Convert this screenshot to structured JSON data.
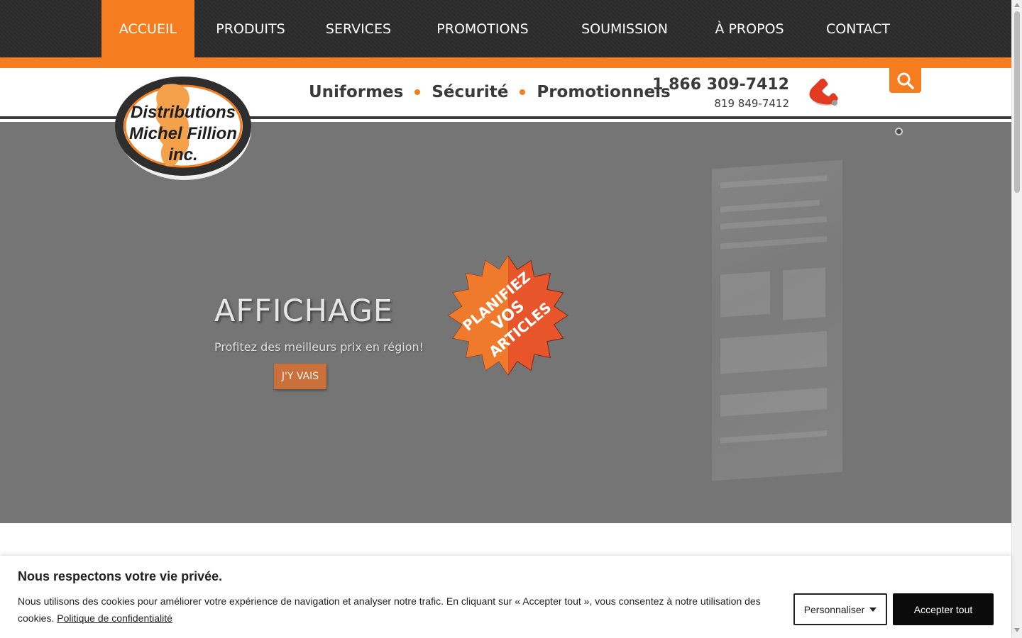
{
  "nav": {
    "items": [
      {
        "label": "ACCUEIL",
        "active": true
      },
      {
        "label": "PRODUITS",
        "active": false
      },
      {
        "label": "SERVICES",
        "active": false
      },
      {
        "label": "PROMOTIONS",
        "active": false
      },
      {
        "label": "SOUMISSION",
        "active": false
      },
      {
        "label": "À PROPOS",
        "active": false
      },
      {
        "label": "CONTACT",
        "active": false
      }
    ]
  },
  "header": {
    "logo_lines": [
      "Distributions",
      "Michel Fillion",
      "inc."
    ],
    "tagline": [
      "Uniformes",
      "Sécurité",
      "Promotionnels"
    ],
    "phone_main": "1 866 309-7412",
    "phone_sub": "819 849-7412",
    "search_icon": "search-icon",
    "phone_icon": "phone-icon"
  },
  "hero": {
    "title": "AFFICHAGE",
    "subtitle": "Profitez des meilleurs prix en région!",
    "button_label": "J'Y VAIS",
    "starburst_lines": [
      "PLANIFIEZ",
      "VOS",
      "ARTICLES"
    ]
  },
  "cookie": {
    "title": "Nous respectons votre vie privée.",
    "text": "Nous utilisons des cookies pour améliorer votre expérience de navigation et analyser notre trafic. En cliquant sur « Accepter tout », vous consentez à notre utilisation des cookies.",
    "link": "Politique de confidentialité",
    "customize_label": "Personnaliser",
    "accept_label": "Accepter tout"
  },
  "colors": {
    "accent": "#f57c1f",
    "nav_bg": "#2b2b2b",
    "hero_bg": "#757575",
    "text_dark": "#3a3a3a",
    "accept_bg": "#0b0b0b"
  }
}
